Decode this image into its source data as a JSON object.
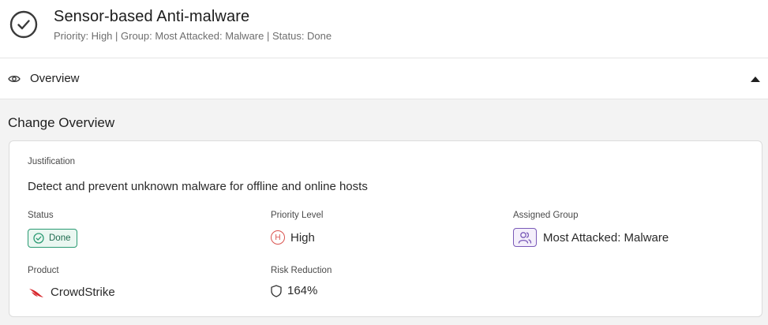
{
  "header": {
    "title": "Sensor-based Anti-malware",
    "subtitle": "Priority: High | Group: Most Attacked: Malware | Status: Done",
    "icon": "check-circle-icon"
  },
  "overview_section": {
    "label": "Overview",
    "icon": "eye-icon",
    "toggle_icon": "caret-up-icon"
  },
  "change_overview": {
    "title": "Change Overview",
    "justification_label": "Justification",
    "justification_text": "Detect and prevent unknown malware for offline and online hosts",
    "status_label": "Status",
    "status_value": "Done",
    "status_color": "#2a9a72",
    "priority_label": "Priority Level",
    "priority_badge": "H",
    "priority_value": "High",
    "priority_color": "#d9534f",
    "group_label": "Assigned Group",
    "group_value": "Most Attacked: Malware",
    "group_color": "#7a5ab8",
    "product_label": "Product",
    "product_value": "CrowdStrike",
    "product_icon": "crowdstrike-falcon-logo",
    "risk_label": "Risk Reduction",
    "risk_value": "164%",
    "risk_icon": "shield-icon"
  }
}
